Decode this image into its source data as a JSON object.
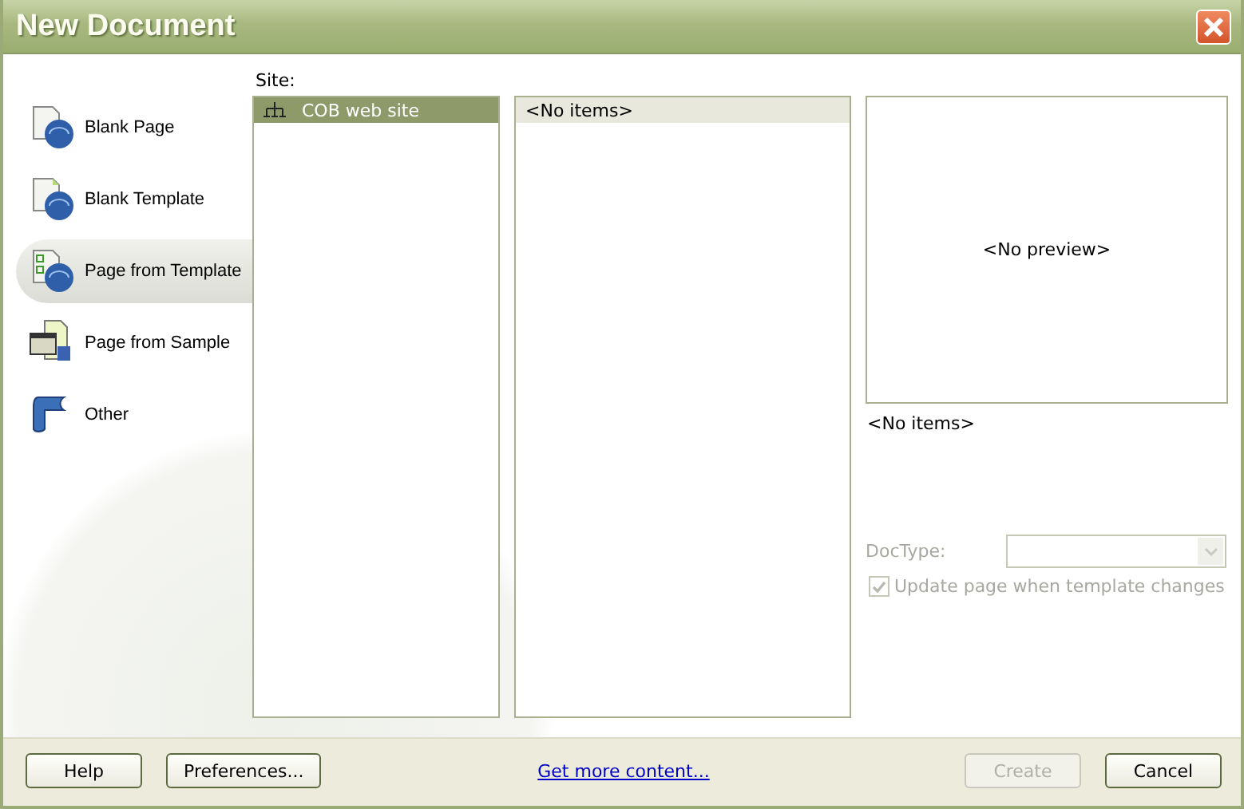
{
  "window": {
    "title": "New Document"
  },
  "categories": [
    {
      "label": "Blank Page",
      "kind": "blank",
      "selected": false
    },
    {
      "label": "Blank Template",
      "kind": "template",
      "selected": false
    },
    {
      "label": "Page from Template",
      "kind": "fromtemplate",
      "selected": true
    },
    {
      "label": "Page from Sample",
      "kind": "sample",
      "selected": false
    },
    {
      "label": "Other",
      "kind": "other",
      "selected": false
    }
  ],
  "site": {
    "label": "Site:",
    "items": [
      {
        "label": "COB web site",
        "selected": true
      }
    ]
  },
  "templates": {
    "items": [
      {
        "label": "<No items>",
        "selected": true
      }
    ]
  },
  "preview": {
    "text": "<No preview>"
  },
  "description": "<No items>",
  "doctype": {
    "label": "DocType:",
    "disabled": true
  },
  "update_checkbox": {
    "label": "Update page when template changes",
    "checked": true,
    "disabled": true
  },
  "footer": {
    "buttons": [
      {
        "label": "Help",
        "disabled": false
      },
      {
        "label": "Preferences...",
        "disabled": false
      }
    ],
    "link": "Get more content...",
    "right_buttons": [
      {
        "label": "Create",
        "disabled": true
      },
      {
        "label": "Cancel",
        "disabled": false
      }
    ]
  }
}
